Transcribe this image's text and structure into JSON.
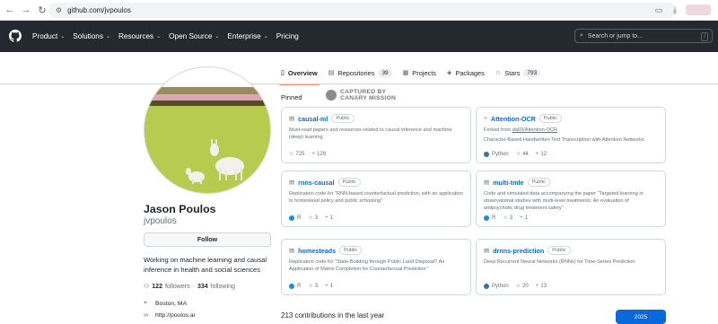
{
  "browser": {
    "url": "github.com/jvpoulos"
  },
  "header": {
    "nav": [
      {
        "label": "Product",
        "dropdown": true
      },
      {
        "label": "Solutions",
        "dropdown": true
      },
      {
        "label": "Resources",
        "dropdown": true
      },
      {
        "label": "Open Source",
        "dropdown": true
      },
      {
        "label": "Enterprise",
        "dropdown": true
      },
      {
        "label": "Pricing",
        "dropdown": false
      }
    ],
    "search_placeholder": "Search or jump to...",
    "search_shortcut": "/"
  },
  "tabs": [
    {
      "label": "Overview",
      "icon": "book-icon",
      "count": null,
      "active": true
    },
    {
      "label": "Repositories",
      "icon": "repo-icon",
      "count": "39",
      "active": false
    },
    {
      "label": "Projects",
      "icon": "table-icon",
      "count": null,
      "active": false
    },
    {
      "label": "Packages",
      "icon": "package-icon",
      "count": null,
      "active": false
    },
    {
      "label": "Stars",
      "icon": "star-icon",
      "count": "793",
      "active": false
    }
  ],
  "profile": {
    "name": "Jason Poulos",
    "login": "jvpoulos",
    "follow_label": "Follow",
    "bio": "Working on machine learning and causal inference in health and social sciences",
    "followers_count": "122",
    "followers_label": "followers",
    "separator": "·",
    "following_count": "334",
    "following_label": "following",
    "location": "Boston, MA",
    "website": "http://poulos.ai"
  },
  "pinned": {
    "label": "Pinned",
    "stamp_line1": "CAPTURED BY",
    "stamp_line2": "CANARY MISSION",
    "cards": [
      {
        "name": "causal-ml",
        "visibility": "Public",
        "fork_prefix": "",
        "fork_source": "",
        "description": "Must-read papers and resources related to causal inference and machine (deep) learning",
        "language": "",
        "language_color": "",
        "stars": "725",
        "forks": "129"
      },
      {
        "name": "Attention-OCR",
        "visibility": "Public",
        "fork_prefix": "Forked from ",
        "fork_source": "da03/Attention-OCR",
        "description": "Character-Based Handwritten Text Transcription with Attention Networks",
        "language": "Python",
        "language_color": "#3572A5",
        "stars": "44",
        "forks": "12"
      },
      {
        "name": "rnns-causal",
        "visibility": "Public",
        "fork_prefix": "",
        "fork_source": "",
        "description": "Replication code for \"RNN-based counterfactual prediction, with an application to homestead policy and public schooling\"",
        "language": "R",
        "language_color": "#198CE7",
        "stars": "3",
        "forks": "1"
      },
      {
        "name": "multi-tmle",
        "visibility": "Public",
        "fork_prefix": "",
        "fork_source": "",
        "description": "Code and simulated data accompanying the paper \"Targeted learning in observational studies with multi-level treatments: An evaluation of antipsychotic drug treatment safety\"",
        "language": "R",
        "language_color": "#198CE7",
        "stars": "3",
        "forks": "1"
      },
      {
        "name": "homesteads",
        "visibility": "Public",
        "fork_prefix": "",
        "fork_source": "",
        "description": "Replication code for \"State-Building through Public Land Disposal? An Application of Matrix Completion for Counterfactual Prediction\"",
        "language": "R",
        "language_color": "#198CE7",
        "stars": "3",
        "forks": "1"
      },
      {
        "name": "drnns-prediction",
        "visibility": "Public",
        "fork_prefix": "",
        "fork_source": "",
        "description": "Deep Recurrent Neural Networks (RNNs) for Time-Series Prediction",
        "language": "Python",
        "language_color": "#3572A5",
        "stars": "20",
        "forks": "13"
      }
    ]
  },
  "contributions": {
    "summary": "213 contributions in the last year",
    "year": "2025"
  }
}
